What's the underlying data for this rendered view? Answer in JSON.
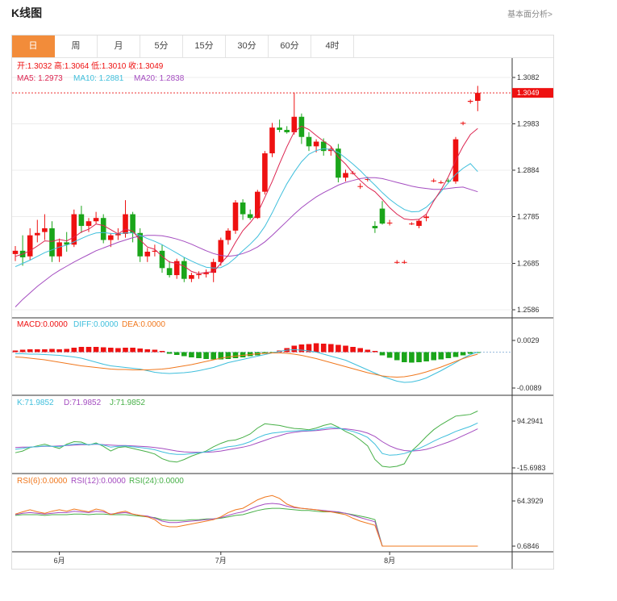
{
  "header": {
    "title": "K线图",
    "link": "基本面分析>"
  },
  "tabs": [
    {
      "label": "日",
      "active": true
    },
    {
      "label": "周",
      "active": false
    },
    {
      "label": "月",
      "active": false
    },
    {
      "label": "5分",
      "active": false
    },
    {
      "label": "15分",
      "active": false
    },
    {
      "label": "30分",
      "active": false
    },
    {
      "label": "60分",
      "active": false
    },
    {
      "label": "4时",
      "active": false
    }
  ],
  "colors": {
    "up": "#ee1111",
    "down": "#1aa51a",
    "ma5": "#dc2450",
    "ma10": "#3fbfdc",
    "ma20": "#a44cc0",
    "macd": "#ee1111",
    "diff": "#3fbfdc",
    "dea": "#f0781e",
    "k": "#3fbfdc",
    "d": "#a44cc0",
    "j": "#47b047",
    "rsi6": "#f0781e",
    "rsi12": "#a44cc0",
    "rsi24": "#47b047",
    "accent": "#f28c3a"
  },
  "legend": {
    "price": [
      {
        "label": "开:",
        "value": "1.3032",
        "color": "#ee1111"
      },
      {
        "label": "高:",
        "value": "1.3064",
        "color": "#ee1111"
      },
      {
        "label": "低:",
        "value": "1.3010",
        "color": "#ee1111"
      },
      {
        "label": "收:",
        "value": "1.3049",
        "color": "#ee1111"
      }
    ],
    "ma": [
      {
        "label": "MA5: ",
        "value": "1.2973",
        "color": "#dc2450"
      },
      {
        "label": "MA10: ",
        "value": "1.2881",
        "color": "#3fbfdc"
      },
      {
        "label": "MA20: ",
        "value": "1.2838",
        "color": "#a44cc0"
      }
    ],
    "macd": [
      {
        "label": "MACD:",
        "value": "0.0000",
        "color": "#ee1111"
      },
      {
        "label": "DIFF:",
        "value": "0.0000",
        "color": "#3fbfdc"
      },
      {
        "label": "DEA:",
        "value": "0.0000",
        "color": "#f0781e"
      }
    ],
    "kdj": [
      {
        "label": "K:",
        "value": "71.9852",
        "color": "#3fbfdc"
      },
      {
        "label": "D:",
        "value": "71.9852",
        "color": "#a44cc0"
      },
      {
        "label": "J:",
        "value": "71.9852",
        "color": "#47b047"
      }
    ],
    "rsi": [
      {
        "label": "RSI(6):",
        "value": "0.0000",
        "color": "#f0781e"
      },
      {
        "label": "RSI(12):",
        "value": "0.0000",
        "color": "#a44cc0"
      },
      {
        "label": "RSI(24):",
        "value": "0.0000",
        "color": "#47b047"
      }
    ]
  },
  "chart_data": {
    "type": "candlestick",
    "current_price": "1.3049",
    "price_axis": {
      "ticks": [
        "1.3082",
        "1.2983",
        "1.2884",
        "1.2785",
        "1.2685",
        "1.2586"
      ],
      "range": [
        1.2586,
        1.3082
      ]
    },
    "macd_axis": {
      "ticks": [
        "0.0029",
        "-0.0089"
      ],
      "range": [
        -0.0089,
        0.0029
      ]
    },
    "kdj_axis": {
      "ticks": [
        "94.2941",
        "-15.6983"
      ],
      "range": [
        -15.6983,
        94.2941
      ]
    },
    "rsi_axis": {
      "ticks": [
        "64.3929",
        "0.6846"
      ],
      "range": [
        0.6846,
        64.3929
      ]
    },
    "x_labels": [
      {
        "label": "6月",
        "index": 6
      },
      {
        "label": "7月",
        "index": 28
      },
      {
        "label": "8月",
        "index": 51
      }
    ],
    "candles": [
      {
        "o": 1.2705,
        "h": 1.2722,
        "l": 1.269,
        "c": 1.2712
      },
      {
        "o": 1.2712,
        "h": 1.2745,
        "l": 1.268,
        "c": 1.2698
      },
      {
        "o": 1.27,
        "h": 1.276,
        "l": 1.2692,
        "c": 1.2745
      },
      {
        "o": 1.2745,
        "h": 1.2778,
        "l": 1.273,
        "c": 1.275
      },
      {
        "o": 1.2752,
        "h": 1.279,
        "l": 1.2735,
        "c": 1.276
      },
      {
        "o": 1.276,
        "h": 1.2775,
        "l": 1.2688,
        "c": 1.27
      },
      {
        "o": 1.27,
        "h": 1.2738,
        "l": 1.2688,
        "c": 1.273
      },
      {
        "o": 1.273,
        "h": 1.2752,
        "l": 1.271,
        "c": 1.2725
      },
      {
        "o": 1.2725,
        "h": 1.28,
        "l": 1.272,
        "c": 1.279
      },
      {
        "o": 1.279,
        "h": 1.2808,
        "l": 1.275,
        "c": 1.2765
      },
      {
        "o": 1.2765,
        "h": 1.2782,
        "l": 1.2752,
        "c": 1.2775
      },
      {
        "o": 1.2775,
        "h": 1.2795,
        "l": 1.277,
        "c": 1.2782
      },
      {
        "o": 1.2782,
        "h": 1.279,
        "l": 1.2728,
        "c": 1.2735
      },
      {
        "o": 1.2735,
        "h": 1.275,
        "l": 1.272,
        "c": 1.2745
      },
      {
        "o": 1.2745,
        "h": 1.276,
        "l": 1.2735,
        "c": 1.2748
      },
      {
        "o": 1.2748,
        "h": 1.282,
        "l": 1.274,
        "c": 1.279
      },
      {
        "o": 1.279,
        "h": 1.2795,
        "l": 1.273,
        "c": 1.275
      },
      {
        "o": 1.275,
        "h": 1.276,
        "l": 1.2688,
        "c": 1.27
      },
      {
        "o": 1.27,
        "h": 1.2718,
        "l": 1.2688,
        "c": 1.271
      },
      {
        "o": 1.271,
        "h": 1.2725,
        "l": 1.27,
        "c": 1.2712
      },
      {
        "o": 1.2712,
        "h": 1.2725,
        "l": 1.2665,
        "c": 1.2675
      },
      {
        "o": 1.2675,
        "h": 1.269,
        "l": 1.2655,
        "c": 1.266
      },
      {
        "o": 1.266,
        "h": 1.2695,
        "l": 1.2652,
        "c": 1.269
      },
      {
        "o": 1.269,
        "h": 1.2698,
        "l": 1.2645,
        "c": 1.2652
      },
      {
        "o": 1.2652,
        "h": 1.2665,
        "l": 1.2645,
        "c": 1.266
      },
      {
        "o": 1.266,
        "h": 1.2668,
        "l": 1.2652,
        "c": 1.2662
      },
      {
        "o": 1.2662,
        "h": 1.2672,
        "l": 1.2655,
        "c": 1.2665
      },
      {
        "o": 1.2665,
        "h": 1.2695,
        "l": 1.2645,
        "c": 1.2688
      },
      {
        "o": 1.2688,
        "h": 1.274,
        "l": 1.268,
        "c": 1.2735
      },
      {
        "o": 1.2735,
        "h": 1.276,
        "l": 1.2725,
        "c": 1.2755
      },
      {
        "o": 1.2755,
        "h": 1.282,
        "l": 1.2748,
        "c": 1.2815
      },
      {
        "o": 1.2815,
        "h": 1.2822,
        "l": 1.2778,
        "c": 1.279
      },
      {
        "o": 1.279,
        "h": 1.28,
        "l": 1.2778,
        "c": 1.2782
      },
      {
        "o": 1.2782,
        "h": 1.2842,
        "l": 1.278,
        "c": 1.2838
      },
      {
        "o": 1.2838,
        "h": 1.2925,
        "l": 1.2832,
        "c": 1.292
      },
      {
        "o": 1.292,
        "h": 1.2985,
        "l": 1.2912,
        "c": 1.2975
      },
      {
        "o": 1.2975,
        "h": 1.2992,
        "l": 1.2965,
        "c": 1.297
      },
      {
        "o": 1.297,
        "h": 1.2978,
        "l": 1.2962,
        "c": 1.2965
      },
      {
        "o": 1.2965,
        "h": 1.305,
        "l": 1.296,
        "c": 1.2998
      },
      {
        "o": 1.2998,
        "h": 1.3005,
        "l": 1.294,
        "c": 1.2955
      },
      {
        "o": 1.2955,
        "h": 1.2965,
        "l": 1.2925,
        "c": 1.2935
      },
      {
        "o": 1.2935,
        "h": 1.295,
        "l": 1.2922,
        "c": 1.2945
      },
      {
        "o": 1.2945,
        "h": 1.2952,
        "l": 1.2915,
        "c": 1.2925
      },
      {
        "o": 1.2925,
        "h": 1.2935,
        "l": 1.2915,
        "c": 1.293
      },
      {
        "o": 1.293,
        "h": 1.294,
        "l": 1.2858,
        "c": 1.2868
      },
      {
        "o": 1.2868,
        "h": 1.2885,
        "l": 1.286,
        "c": 1.2878
      },
      {
        "o": 1.2878,
        "h": 1.2882,
        "l": 1.2875,
        "c": 1.2878
      },
      {
        "o": 1.285,
        "h": 1.2856,
        "l": 1.2844,
        "c": 1.285
      },
      {
        "o": 1.2865,
        "h": 1.287,
        "l": 1.286,
        "c": 1.2865
      },
      {
        "o": 1.2765,
        "h": 1.2775,
        "l": 1.275,
        "c": 1.276
      },
      {
        "o": 1.2802,
        "h": 1.2818,
        "l": 1.2768,
        "c": 1.277
      },
      {
        "o": 1.2772,
        "h": 1.2778,
        "l": 1.2766,
        "c": 1.2772
      },
      {
        "o": 1.2688,
        "h": 1.2692,
        "l": 1.2684,
        "c": 1.2688
      },
      {
        "o": 1.2688,
        "h": 1.2692,
        "l": 1.2684,
        "c": 1.2688
      },
      {
        "o": 1.277,
        "h": 1.2773,
        "l": 1.2767,
        "c": 1.277
      },
      {
        "o": 1.2765,
        "h": 1.278,
        "l": 1.276,
        "c": 1.2776
      },
      {
        "o": 1.2782,
        "h": 1.279,
        "l": 1.2775,
        "c": 1.2785
      },
      {
        "o": 1.2862,
        "h": 1.2866,
        "l": 1.2858,
        "c": 1.2862
      },
      {
        "o": 1.2858,
        "h": 1.2862,
        "l": 1.2855,
        "c": 1.2858
      },
      {
        "o": 1.2862,
        "h": 1.2866,
        "l": 1.2856,
        "c": 1.286
      },
      {
        "o": 1.286,
        "h": 1.2955,
        "l": 1.2855,
        "c": 1.295
      },
      {
        "o": 1.2985,
        "h": 1.2988,
        "l": 1.298,
        "c": 1.2985
      },
      {
        "o": 1.303,
        "h": 1.3035,
        "l": 1.3026,
        "c": 1.3032
      },
      {
        "o": 1.3032,
        "h": 1.3064,
        "l": 1.301,
        "c": 1.3049
      }
    ],
    "ma5": [
      1.27,
      1.2705,
      1.2712,
      1.2722,
      1.2733,
      1.2732,
      1.2736,
      1.2733,
      1.2741,
      1.2752,
      1.2758,
      1.2769,
      1.2766,
      1.2757,
      1.2748,
      1.2758,
      1.2754,
      1.2735,
      1.272,
      1.2715,
      1.27,
      1.2688,
      1.2685,
      1.2679,
      1.2668,
      1.2663,
      1.2666,
      1.2667,
      1.2685,
      1.2702,
      1.273,
      1.2755,
      1.2772,
      1.2792,
      1.2826,
      1.286,
      1.2898,
      1.2934,
      1.2966,
      1.2978,
      1.2971,
      1.2958,
      1.2946,
      1.2935,
      1.2912,
      1.2897,
      1.2878,
      1.2862,
      1.2848,
      1.2838,
      1.2822,
      1.2804,
      1.279,
      1.278,
      1.2778,
      1.2779,
      1.279,
      1.2818,
      1.2842,
      1.287,
      1.2905,
      1.2935,
      1.296,
      1.2973
    ],
    "ma10": [
      1.2678,
      1.2685,
      1.2692,
      1.27,
      1.2708,
      1.2714,
      1.272,
      1.2724,
      1.2731,
      1.2738,
      1.2745,
      1.275,
      1.2751,
      1.2749,
      1.2748,
      1.275,
      1.275,
      1.2745,
      1.2738,
      1.2732,
      1.2725,
      1.2716,
      1.2707,
      1.2698,
      1.269,
      1.2683,
      1.2677,
      1.2675,
      1.2676,
      1.2684,
      1.2697,
      1.2712,
      1.2726,
      1.2742,
      1.2764,
      1.2793,
      1.2825,
      1.2855,
      1.288,
      1.2902,
      1.2918,
      1.2926,
      1.293,
      1.2928,
      1.2922,
      1.291,
      1.2897,
      1.2883,
      1.2867,
      1.2852,
      1.2836,
      1.2822,
      1.281,
      1.28,
      1.2795,
      1.2796,
      1.2805,
      1.282,
      1.2838,
      1.2857,
      1.2875,
      1.2888,
      1.2898,
      1.2881
    ],
    "ma20": [
      1.2592,
      1.2608,
      1.2622,
      1.2636,
      1.2648,
      1.266,
      1.267,
      1.2679,
      1.2688,
      1.2696,
      1.2704,
      1.2712,
      1.2718,
      1.2724,
      1.273,
      1.2735,
      1.274,
      1.2743,
      1.2745,
      1.2745,
      1.2744,
      1.2741,
      1.2737,
      1.2732,
      1.2726,
      1.2719,
      1.2712,
      1.2706,
      1.2702,
      1.27,
      1.2702,
      1.2706,
      1.2712,
      1.272,
      1.2731,
      1.2745,
      1.276,
      1.2775,
      1.279,
      1.2804,
      1.2816,
      1.2827,
      1.2836,
      1.2844,
      1.2852,
      1.2858,
      1.2862,
      1.2866,
      1.2868,
      1.2868,
      1.2866,
      1.2862,
      1.2858,
      1.2854,
      1.285,
      1.2847,
      1.2845,
      1.2843,
      1.2843,
      1.2845,
      1.2847,
      1.2848,
      1.2843,
      1.2838
    ],
    "macd_hist": [
      0.0004,
      0.0006,
      0.0007,
      0.0007,
      0.0007,
      0.0008,
      0.0007,
      0.0008,
      0.0011,
      0.0013,
      0.0013,
      0.0013,
      0.0012,
      0.0011,
      0.001,
      0.0011,
      0.0011,
      0.0009,
      0.0007,
      0.0006,
      0.0003,
      -0.0004,
      -0.0007,
      -0.001,
      -0.0013,
      -0.0015,
      -0.0017,
      -0.0018,
      -0.0018,
      -0.0017,
      -0.0015,
      -0.0013,
      -0.001,
      -0.0008,
      -0.0004,
      -0.0001,
      0.0004,
      0.001,
      0.0016,
      0.0019,
      0.002,
      0.0022,
      0.0021,
      0.002,
      0.0018,
      0.0016,
      0.0013,
      0.001,
      0.0006,
      0.0003,
      -0.0008,
      -0.0014,
      -0.002,
      -0.0025,
      -0.0026,
      -0.0025,
      -0.0023,
      -0.002,
      -0.0018,
      -0.0015,
      -0.0012,
      -0.0008,
      -0.0004,
      -0.0001
    ],
    "macd_diff": [
      -0.0004,
      -0.0004,
      -0.0005,
      -0.0005,
      -0.0006,
      -0.0007,
      -0.0008,
      -0.001,
      -0.0012,
      -0.0015,
      -0.002,
      -0.0025,
      -0.003,
      -0.0034,
      -0.0036,
      -0.0038,
      -0.004,
      -0.0042,
      -0.0046,
      -0.005,
      -0.0052,
      -0.0053,
      -0.0052,
      -0.0051,
      -0.0049,
      -0.0046,
      -0.0042,
      -0.0038,
      -0.0032,
      -0.0026,
      -0.0022,
      -0.0018,
      -0.0014,
      -0.001,
      -0.0006,
      -0.0002,
      0.0002,
      0.0005,
      0.0006,
      0.0005,
      0.0003,
      0.0,
      -0.0005,
      -0.001,
      -0.0015,
      -0.002,
      -0.0028,
      -0.0036,
      -0.0044,
      -0.0052,
      -0.006,
      -0.0066,
      -0.0072,
      -0.0075,
      -0.0074,
      -0.007,
      -0.0064,
      -0.0055,
      -0.0046,
      -0.0036,
      -0.0026,
      -0.0015,
      -0.0006,
      0.0
    ],
    "macd_dea": [
      -0.0012,
      -0.0013,
      -0.0015,
      -0.0017,
      -0.0019,
      -0.0022,
      -0.0025,
      -0.0028,
      -0.0031,
      -0.0034,
      -0.0036,
      -0.0038,
      -0.004,
      -0.0042,
      -0.0043,
      -0.0043,
      -0.0044,
      -0.0044,
      -0.0044,
      -0.0043,
      -0.0042,
      -0.004,
      -0.0037,
      -0.0034,
      -0.0031,
      -0.0027,
      -0.0023,
      -0.0019,
      -0.0015,
      -0.0012,
      -0.001,
      -0.0008,
      -0.0006,
      -0.0004,
      -0.0003,
      -0.0002,
      -0.0002,
      -0.0003,
      -0.0005,
      -0.0008,
      -0.0012,
      -0.0016,
      -0.0021,
      -0.0026,
      -0.0031,
      -0.0036,
      -0.0041,
      -0.0046,
      -0.0051,
      -0.0055,
      -0.0059,
      -0.0061,
      -0.0062,
      -0.0061,
      -0.0058,
      -0.0054,
      -0.0049,
      -0.0043,
      -0.0037,
      -0.003,
      -0.0023,
      -0.0016,
      -0.001,
      -0.0005
    ],
    "kdj_k": [
      28,
      30,
      33,
      34,
      36,
      35,
      34,
      38,
      40,
      41,
      39,
      41,
      38,
      33,
      35,
      36,
      34,
      32,
      30,
      27,
      22,
      18,
      16,
      16,
      18,
      20,
      22,
      26,
      30,
      34,
      36,
      40,
      46,
      55,
      62,
      66,
      68,
      70,
      71,
      72,
      72,
      74,
      77,
      80,
      78,
      74,
      70,
      64,
      56,
      40,
      18,
      14,
      15,
      18,
      24,
      30,
      38,
      47,
      55,
      62,
      70,
      76,
      82,
      90
    ],
    "kdj_d": [
      32,
      33,
      33,
      34,
      35,
      35,
      36,
      37,
      38,
      39,
      39,
      40,
      39,
      38,
      37,
      37,
      36,
      35,
      34,
      32,
      30,
      27,
      24,
      22,
      21,
      21,
      21,
      22,
      24,
      27,
      30,
      33,
      37,
      43,
      49,
      55,
      60,
      65,
      68,
      70,
      71,
      72,
      74,
      76,
      77,
      76,
      74,
      71,
      66,
      58,
      46,
      36,
      29,
      25,
      24,
      25,
      28,
      33,
      39,
      45,
      52,
      60,
      68,
      76
    ],
    "kdj_j": [
      20,
      24,
      32,
      36,
      40,
      35,
      30,
      40,
      46,
      45,
      38,
      43,
      35,
      24,
      32,
      34,
      30,
      26,
      22,
      17,
      6,
      0,
      -2,
      4,
      12,
      18,
      24,
      34,
      42,
      48,
      50,
      56,
      64,
      78,
      88,
      86,
      84,
      80,
      77,
      76,
      74,
      78,
      84,
      88,
      80,
      70,
      62,
      50,
      36,
      4,
      -12,
      -14,
      -12,
      -6,
      24,
      40,
      58,
      74,
      86,
      96,
      106,
      108,
      110,
      118
    ],
    "rsi6": [
      46,
      49,
      52,
      49,
      47,
      50,
      52,
      50,
      53,
      51,
      49,
      53,
      51,
      45,
      48,
      50,
      46,
      44,
      42,
      38,
      30,
      28,
      28,
      30,
      32,
      34,
      36,
      38,
      42,
      48,
      52,
      54,
      60,
      66,
      70,
      72,
      68,
      60,
      56,
      54,
      53,
      52,
      50,
      49,
      47,
      45,
      40,
      36,
      33,
      30,
      0.7,
      0.7,
      0.7,
      0.7,
      0.7,
      0.7,
      0.7,
      0.7,
      0.7,
      0.7,
      0.7,
      0.7,
      0.7,
      0.7
    ],
    "rsi12": [
      45,
      47,
      48,
      47,
      46,
      47,
      48,
      48,
      50,
      49,
      48,
      50,
      49,
      46,
      47,
      48,
      46,
      44,
      43,
      40,
      36,
      34,
      34,
      35,
      36,
      37,
      38,
      39,
      41,
      44,
      47,
      49,
      53,
      57,
      60,
      61,
      60,
      57,
      55,
      54,
      53,
      52,
      51,
      50,
      49,
      47,
      44,
      41,
      38,
      35,
      0.7,
      0.7,
      0.7,
      0.7,
      0.7,
      0.7,
      0.7,
      0.7,
      0.7,
      0.7,
      0.7,
      0.7,
      0.7,
      0.7
    ],
    "rsi24": [
      44,
      45,
      45,
      45,
      44,
      45,
      45,
      45,
      46,
      46,
      45,
      46,
      46,
      45,
      45,
      45,
      44,
      43,
      42,
      41,
      38,
      37,
      37,
      37,
      38,
      38,
      39,
      39,
      40,
      42,
      44,
      45,
      48,
      51,
      53,
      54,
      54,
      53,
      52,
      51,
      51,
      50,
      49,
      49,
      48,
      47,
      45,
      43,
      41,
      38,
      0.7,
      0.7,
      0.7,
      0.7,
      0.7,
      0.7,
      0.7,
      0.7,
      0.7,
      0.7,
      0.7,
      0.7,
      0.7,
      0.7
    ]
  }
}
